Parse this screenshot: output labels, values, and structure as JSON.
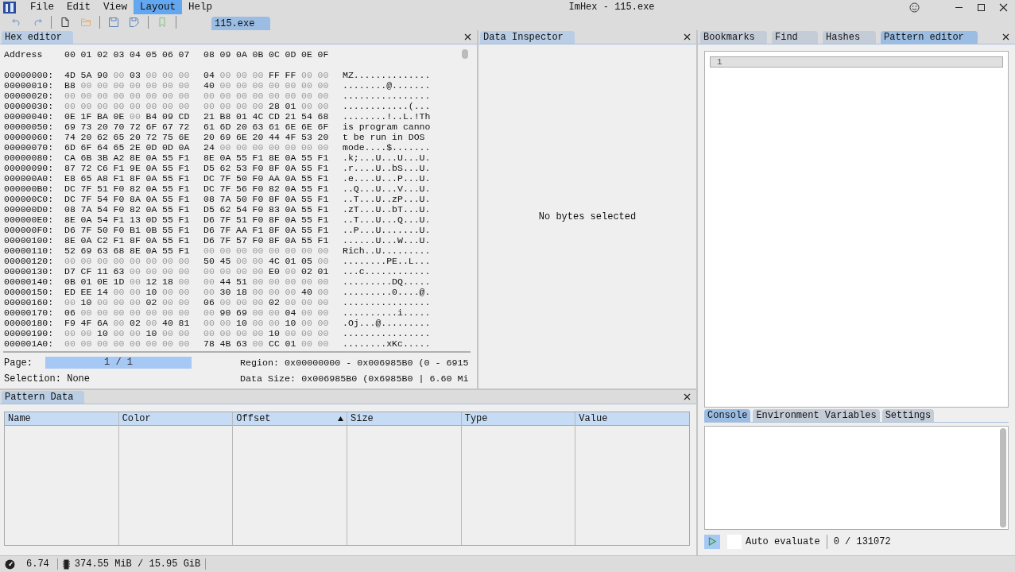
{
  "menu": [
    {
      "label": "File",
      "selected": false
    },
    {
      "label": "Edit",
      "selected": false
    },
    {
      "label": "View",
      "selected": false
    },
    {
      "label": "Layout",
      "selected": true
    },
    {
      "label": "Help",
      "selected": false
    }
  ],
  "window": {
    "title": "ImHex - 115.exe"
  },
  "file_tab": {
    "label": "115.exe",
    "selected": true
  },
  "hex_editor": {
    "tab": "Hex editor",
    "address_header": "Address",
    "columns": [
      "00",
      "01",
      "02",
      "03",
      "04",
      "05",
      "06",
      "07",
      "08",
      "09",
      "0A",
      "0B",
      "0C",
      "0D",
      "0E",
      "0F"
    ],
    "rows": [
      {
        "address": "00000000:",
        "bytes": "4D 5A 90 00 03 00 00 00 04 00 00 00 FF FF 00 00",
        "ascii": "MZ.............."
      },
      {
        "address": "00000010:",
        "bytes": "B8 00 00 00 00 00 00 00 40 00 00 00 00 00 00 00",
        "ascii": "........@......."
      },
      {
        "address": "00000020:",
        "bytes": "00 00 00 00 00 00 00 00 00 00 00 00 00 00 00 00",
        "ascii": "................"
      },
      {
        "address": "00000030:",
        "bytes": "00 00 00 00 00 00 00 00 00 00 00 00 28 01 00 00",
        "ascii": "............(..."
      },
      {
        "address": "00000040:",
        "bytes": "0E 1F BA 0E 00 B4 09 CD 21 B8 01 4C CD 21 54 68",
        "ascii": "........!..L.!Th"
      },
      {
        "address": "00000050:",
        "bytes": "69 73 20 70 72 6F 67 72 61 6D 20 63 61 6E 6E 6F",
        "ascii": "is program canno"
      },
      {
        "address": "00000060:",
        "bytes": "74 20 62 65 20 72 75 6E 20 69 6E 20 44 4F 53 20",
        "ascii": "t be run in DOS "
      },
      {
        "address": "00000070:",
        "bytes": "6D 6F 64 65 2E 0D 0D 0A 24 00 00 00 00 00 00 00",
        "ascii": "mode....$......."
      },
      {
        "address": "00000080:",
        "bytes": "CA 6B 3B A2 8E 0A 55 F1 8E 0A 55 F1 8E 0A 55 F1",
        "ascii": ".k;...U...U...U."
      },
      {
        "address": "00000090:",
        "bytes": "87 72 C6 F1 9E 0A 55 F1 D5 62 53 F0 8F 0A 55 F1",
        "ascii": ".r....U..bS...U."
      },
      {
        "address": "000000A0:",
        "bytes": "E8 65 A8 F1 8F 0A 55 F1 DC 7F 50 F0 AA 0A 55 F1",
        "ascii": ".e....U...P...U."
      },
      {
        "address": "000000B0:",
        "bytes": "DC 7F 51 F0 82 0A 55 F1 DC 7F 56 F0 82 0A 55 F1",
        "ascii": "..Q...U...V...U."
      },
      {
        "address": "000000C0:",
        "bytes": "DC 7F 54 F0 8A 0A 55 F1 08 7A 50 F0 8F 0A 55 F1",
        "ascii": "..T...U..zP...U."
      },
      {
        "address": "000000D0:",
        "bytes": "08 7A 54 F0 82 0A 55 F1 D5 62 54 F0 83 0A 55 F1",
        "ascii": ".zT...U..bT...U."
      },
      {
        "address": "000000E0:",
        "bytes": "8E 0A 54 F1 13 0D 55 F1 D6 7F 51 F0 8F 0A 55 F1",
        "ascii": "..T...U...Q...U."
      },
      {
        "address": "000000F0:",
        "bytes": "D6 7F 50 F0 B1 0B 55 F1 D6 7F AA F1 8F 0A 55 F1",
        "ascii": "..P...U.......U."
      },
      {
        "address": "00000100:",
        "bytes": "8E 0A C2 F1 8F 0A 55 F1 D6 7F 57 F0 8F 0A 55 F1",
        "ascii": "......U...W...U."
      },
      {
        "address": "00000110:",
        "bytes": "52 69 63 68 8E 0A 55 F1 00 00 00 00 00 00 00 00",
        "ascii": "Rich..U........."
      },
      {
        "address": "00000120:",
        "bytes": "00 00 00 00 00 00 00 00 50 45 00 00 4C 01 05 00",
        "ascii": "........PE..L..."
      },
      {
        "address": "00000130:",
        "bytes": "D7 CF 11 63 00 00 00 00 00 00 00 00 E0 00 02 01",
        "ascii": "...c............"
      },
      {
        "address": "00000140:",
        "bytes": "0B 01 0E 1D 00 12 18 00 00 44 51 00 00 00 00 00",
        "ascii": ".........DQ....."
      },
      {
        "address": "00000150:",
        "bytes": "ED EE 14 00 00 10 00 00 00 30 18 00 00 00 40 00",
        "ascii": ".........0....@."
      },
      {
        "address": "00000160:",
        "bytes": "00 10 00 00 00 02 00 00 06 00 00 00 02 00 00 00",
        "ascii": "................"
      },
      {
        "address": "00000170:",
        "bytes": "06 00 00 00 00 00 00 00 00 90 69 00 00 04 00 00",
        "ascii": "..........i....."
      },
      {
        "address": "00000180:",
        "bytes": "F9 4F 6A 00 02 00 40 81 00 00 10 00 00 10 00 00",
        "ascii": ".Oj...@........."
      },
      {
        "address": "00000190:",
        "bytes": "00 00 10 00 00 10 00 00 00 00 00 00 10 00 00 00",
        "ascii": "................"
      },
      {
        "address": "000001A0:",
        "bytes": "00 00 00 00 00 00 00 00 78 4B 63 00 CC 01 00 00",
        "ascii": "........xKc....."
      }
    ],
    "page_label": "Page:",
    "page": "1 / 1",
    "region": "Region: 0x00000000 - 0x006985B0 (0 - 6915",
    "selection": "Selection: None",
    "data_size": "Data Size: 0x006985B0 (0x6985B0 | 6.60 Mi"
  },
  "data_inspector": {
    "tab": "Data Inspector",
    "message": "No bytes selected"
  },
  "right_tabs": [
    {
      "label": "Bookmarks",
      "selected": false
    },
    {
      "label": "Find",
      "selected": false
    },
    {
      "label": "Hashes",
      "selected": false
    },
    {
      "label": "Pattern editor",
      "selected": true
    }
  ],
  "editor": {
    "line_number": "1"
  },
  "console_tabs": [
    {
      "label": "Console",
      "selected": true
    },
    {
      "label": "Environment Variables",
      "selected": false
    },
    {
      "label": "Settings",
      "selected": false
    }
  ],
  "auto_evaluate": {
    "label": "Auto evaluate",
    "checked": false
  },
  "counter": "0 / 131072",
  "pattern_data": {
    "tab": "Pattern Data",
    "columns": [
      {
        "label": "Name",
        "sorted": false
      },
      {
        "label": "Color",
        "sorted": false
      },
      {
        "label": "Offset",
        "sorted": true
      },
      {
        "label": "Size",
        "sorted": false
      },
      {
        "label": "Type",
        "sorted": false
      },
      {
        "label": "Value",
        "sorted": false
      }
    ]
  },
  "status_bar": {
    "fps": "6.74",
    "memory": "374.55 MiB / 15.95 GiB"
  }
}
